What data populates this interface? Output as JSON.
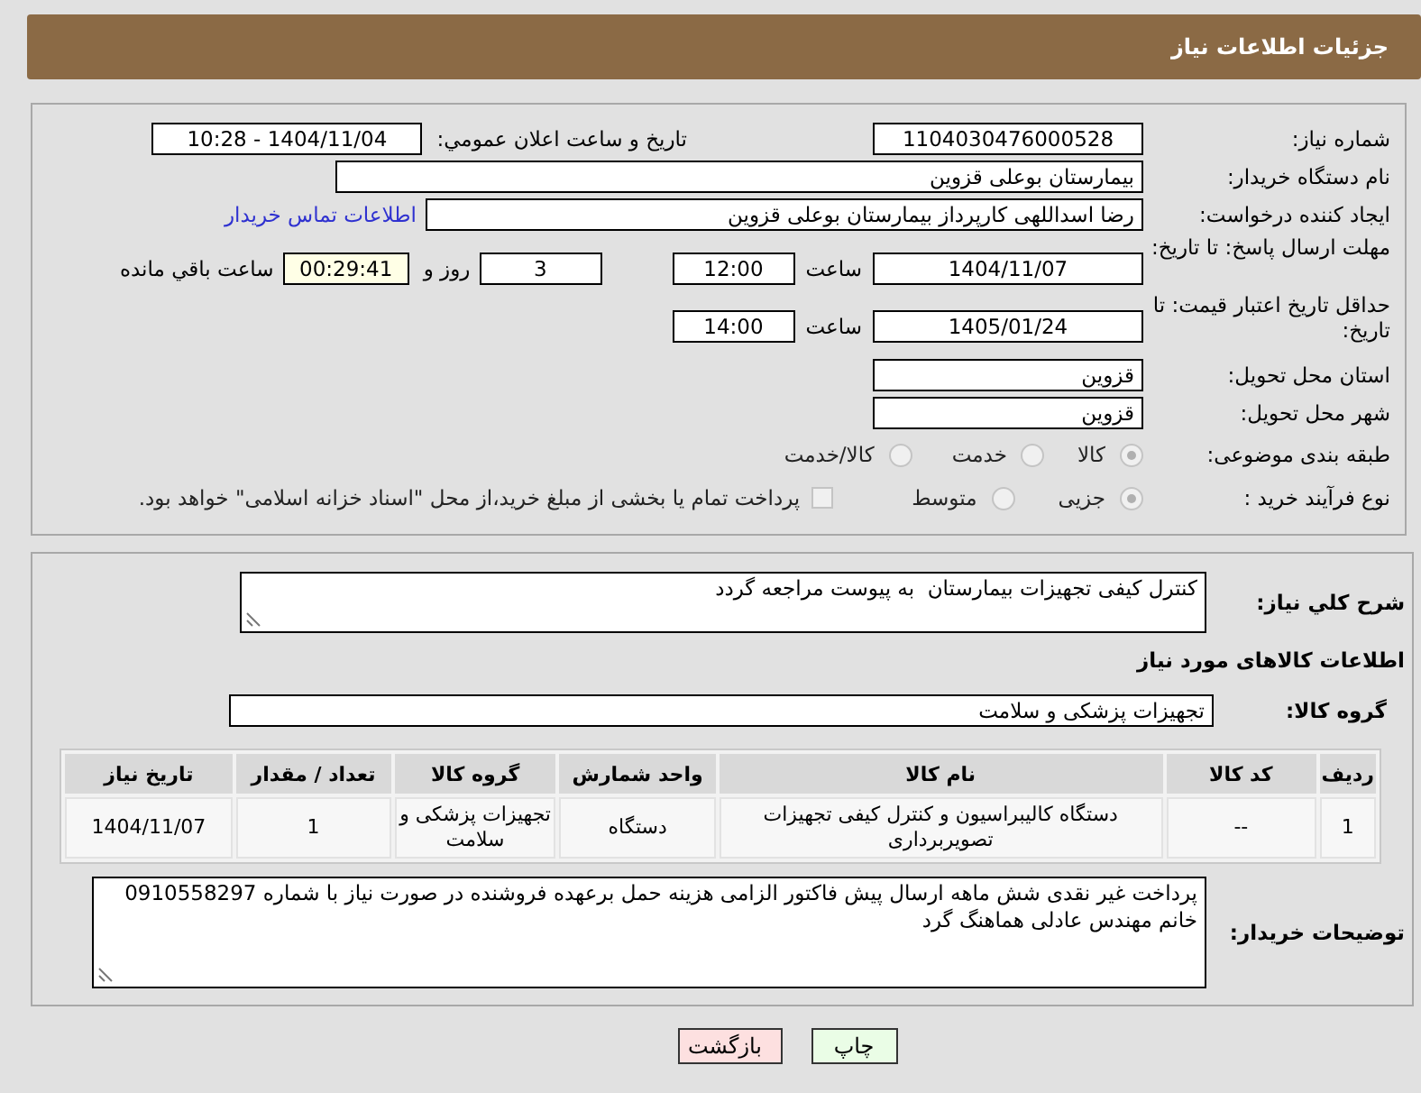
{
  "header": {
    "title": "جزئیات اطلاعات نیاز"
  },
  "need_number": {
    "label": "شماره نیاز:",
    "value": "1104030476000528"
  },
  "announce": {
    "label": "تاریخ و ساعت اعلان عمومي:",
    "value": "1404/11/04 - 10:28"
  },
  "buyer_org": {
    "label": "نام دستگاه خریدار:",
    "value": "بیمارستان بوعلی قزوین"
  },
  "requester": {
    "label": "ایجاد کننده درخواست:",
    "value": "رضا اسداللهی کارپرداز بیمارستان بوعلی قزوین",
    "link": "اطلاعات تماس خریدار"
  },
  "response_deadline": {
    "label": "مهلت ارسال پاسخ: تا تاریخ:",
    "date": "1404/11/07",
    "time_label": "ساعت",
    "time": "12:00",
    "days": "3",
    "days_label": "روز و",
    "remaining": "00:29:41",
    "remaining_label": "ساعت باقي مانده"
  },
  "price_validity": {
    "label": "حداقل تاریخ اعتبار قیمت: تا تاریخ:",
    "date": "1405/01/24",
    "time_label": "ساعت",
    "time": "14:00"
  },
  "province": {
    "label": "استان محل تحویل:",
    "value": "قزوین"
  },
  "city": {
    "label": "شهر محل تحویل:",
    "value": "قزوین"
  },
  "category": {
    "label": "طبقه بندی موضوعی:",
    "options": [
      {
        "label": "کالا",
        "selected": true
      },
      {
        "label": "خدمت",
        "selected": false
      },
      {
        "label": "کالا/خدمت",
        "selected": false
      }
    ]
  },
  "purchase_type": {
    "label": "نوع فرآیند خرید :",
    "options": [
      {
        "label": "جزیی",
        "selected": true
      },
      {
        "label": "متوسط",
        "selected": false
      }
    ],
    "treasury": {
      "label": "پرداخت تمام یا بخشی از مبلغ خرید،از محل \"اسناد خزانه اسلامی\" خواهد بود.",
      "checked": false
    }
  },
  "description": {
    "label": "شرح کلي نیاز:",
    "value": "کنترل کیفی تجهیزات بیمارستان  به پیوست مراجعه گردد"
  },
  "goods_heading": "اطلاعات کالاهای مورد نیاز",
  "goods_group": {
    "label": "گروه کالا:",
    "value": "تجهیزات پزشکی و سلامت"
  },
  "table": {
    "columns": [
      "ردیف",
      "کد کالا",
      "نام کالا",
      "واحد شمارش",
      "گروه کالا",
      "تعداد / مقدار",
      "تاریخ نیاز"
    ],
    "rows": [
      [
        "1",
        "--",
        "دستگاه کالیبراسیون و کنترل کیفی تجهیزات تصویربرداری",
        "دستگاه",
        "تجهیزات پزشکی و سلامت",
        "1",
        "1404/11/07"
      ]
    ]
  },
  "buyer_notes": {
    "label": "توضیحات خریدار:",
    "value": "پرداخت غیر نقدی شش ماهه ارسال پیش فاکتور الزامی هزینه حمل برعهده فروشنده در صورت نیاز با شماره 0910558297\nخانم مهندس عادلی هماهنگ گرد"
  },
  "buttons": [
    {
      "label": "چاپ",
      "kind": "print"
    },
    {
      "label": "بازگشت",
      "kind": "back"
    }
  ]
}
